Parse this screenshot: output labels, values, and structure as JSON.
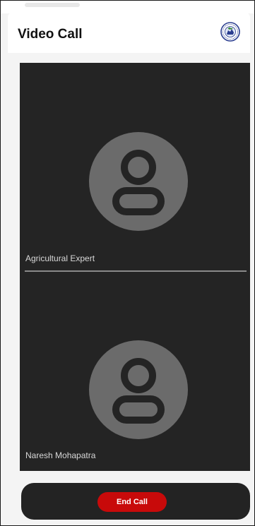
{
  "app": {
    "title": "Video Call",
    "logo_icon": "state-emblem-icon"
  },
  "participants": [
    {
      "name": "Agricultural Expert",
      "avatar_icon": "person-avatar-icon",
      "video": "off"
    },
    {
      "name": "Naresh Mohapatra",
      "avatar_icon": "person-avatar-icon",
      "video": "off"
    }
  ],
  "controls": {
    "end_call_label": "End Call"
  },
  "colors": {
    "video_background": "#242424",
    "avatar_fill": "#6b6b6b",
    "end_call": "#c80a0a",
    "app_bar": "#ffffff"
  }
}
